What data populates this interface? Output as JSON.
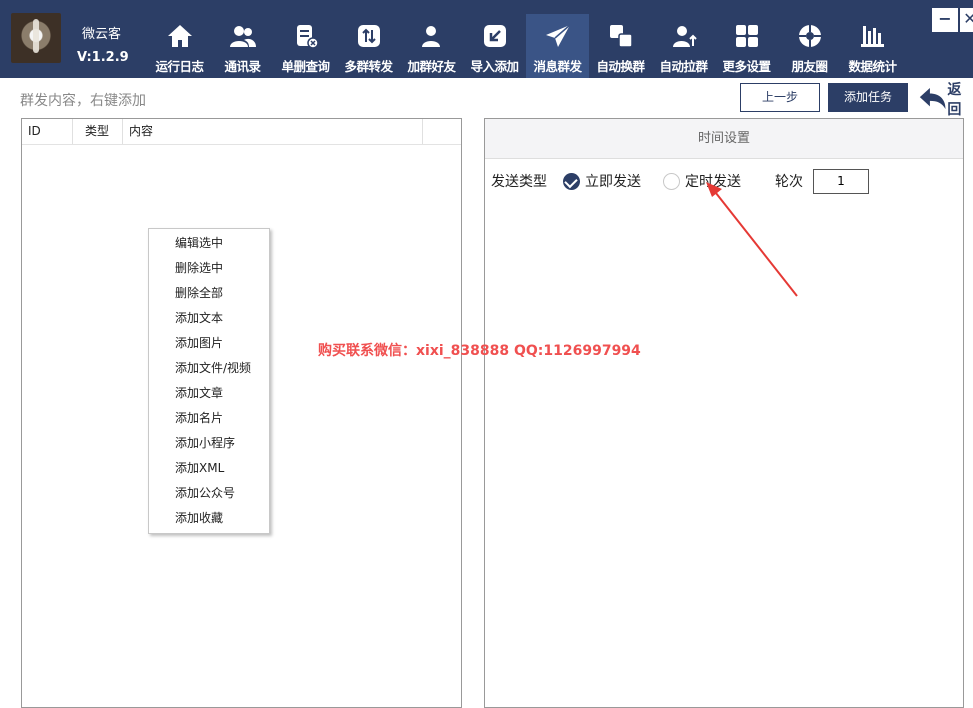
{
  "app": {
    "name": "微云客",
    "version": "V:1.2.9"
  },
  "nav": [
    {
      "label": "运行日志",
      "icon": "home-icon",
      "active": false
    },
    {
      "label": "通讯录",
      "icon": "contacts-icon",
      "active": false
    },
    {
      "label": "单删查询",
      "icon": "delete-check-icon",
      "active": false
    },
    {
      "label": "多群转发",
      "icon": "forward-icon",
      "active": false
    },
    {
      "label": "加群好友",
      "icon": "add-friend-icon",
      "active": false
    },
    {
      "label": "导入添加",
      "icon": "import-icon",
      "active": false
    },
    {
      "label": "消息群发",
      "icon": "send-icon",
      "active": true
    },
    {
      "label": "自动换群",
      "icon": "switch-group-icon",
      "active": false
    },
    {
      "label": "自动拉群",
      "icon": "pull-group-icon",
      "active": false
    },
    {
      "label": "更多设置",
      "icon": "grid-icon",
      "active": false
    },
    {
      "label": "朋友圈",
      "icon": "moments-icon",
      "active": false
    },
    {
      "label": "数据统计",
      "icon": "bar-chart-icon",
      "active": false
    }
  ],
  "window": {
    "minimize": "−",
    "close": "✕"
  },
  "toolbar": {
    "hint": "群发内容，右键添加",
    "prev_label": "上一步",
    "add_task_label": "添加任务",
    "back_label": "返回"
  },
  "table": {
    "columns": [
      "ID",
      "类型",
      "内容"
    ]
  },
  "context_menu": [
    "编辑选中",
    "删除选中",
    "删除全部",
    "添加文本",
    "添加图片",
    "添加文件/视频",
    "添加文章",
    "添加名片",
    "添加小程序",
    "添加XML",
    "添加公众号",
    "添加收藏"
  ],
  "time_settings": {
    "title": "时间设置",
    "send_type_label": "发送类型",
    "option_now": "立即发送",
    "option_timed": "定时发送",
    "selected": "立即发送",
    "rounds_label": "轮次",
    "rounds_value": "1"
  },
  "watermark": "购买联系微信：xixi_838888   QQ:1126997994",
  "colors": {
    "topbar": "#2c3e66",
    "active_tab": "#3a5486",
    "annotation": "#e53935"
  }
}
